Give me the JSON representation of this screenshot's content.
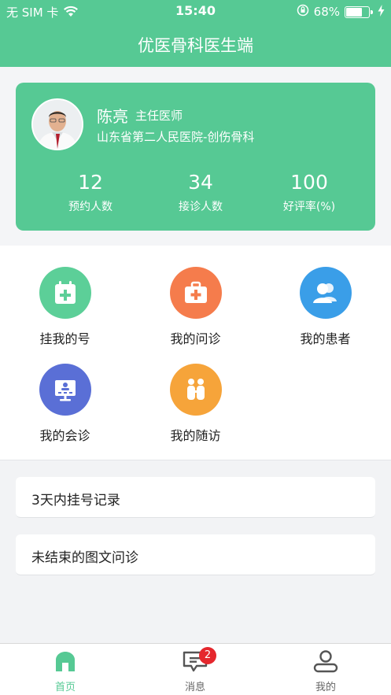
{
  "status_bar": {
    "carrier": "无 SIM 卡",
    "time": "15:40",
    "battery_text": "68%",
    "battery_level": 0.68,
    "icons": [
      "wifi-icon",
      "orientation-lock-icon",
      "battery-icon",
      "charging-icon"
    ]
  },
  "nav": {
    "title": "优医骨科医生端"
  },
  "profile": {
    "name": "陈亮",
    "title": "主任医师",
    "hospital": "山东省第二人民医院-创伤骨科",
    "stats": [
      {
        "value": "12",
        "label": "预约人数"
      },
      {
        "value": "34",
        "label": "接诊人数"
      },
      {
        "value": "100",
        "label": "好评率(%)"
      }
    ]
  },
  "functions": [
    {
      "label": "挂我的号",
      "icon": "calendar-plus-icon",
      "color": "#5ccf98"
    },
    {
      "label": "我的问诊",
      "icon": "medical-kit-icon",
      "color": "#f57c4c"
    },
    {
      "label": "我的患者",
      "icon": "patients-icon",
      "color": "#3a9ee8"
    },
    {
      "label": "我的会诊",
      "icon": "consultation-screen-icon",
      "color": "#5a6fd6"
    },
    {
      "label": "我的随访",
      "icon": "follow-up-icon",
      "color": "#f6a43a"
    }
  ],
  "records": [
    {
      "label": "3天内挂号记录"
    },
    {
      "label": "未结束的图文问诊"
    }
  ],
  "tabbar": {
    "tabs": [
      {
        "label": "首页",
        "icon": "home-icon",
        "active": true
      },
      {
        "label": "消息",
        "icon": "message-icon",
        "badge": "2"
      },
      {
        "label": "我的",
        "icon": "user-icon"
      }
    ]
  },
  "colors": {
    "primary": "#56c994",
    "badge": "#e5272d",
    "background": "#f2f3f5"
  }
}
